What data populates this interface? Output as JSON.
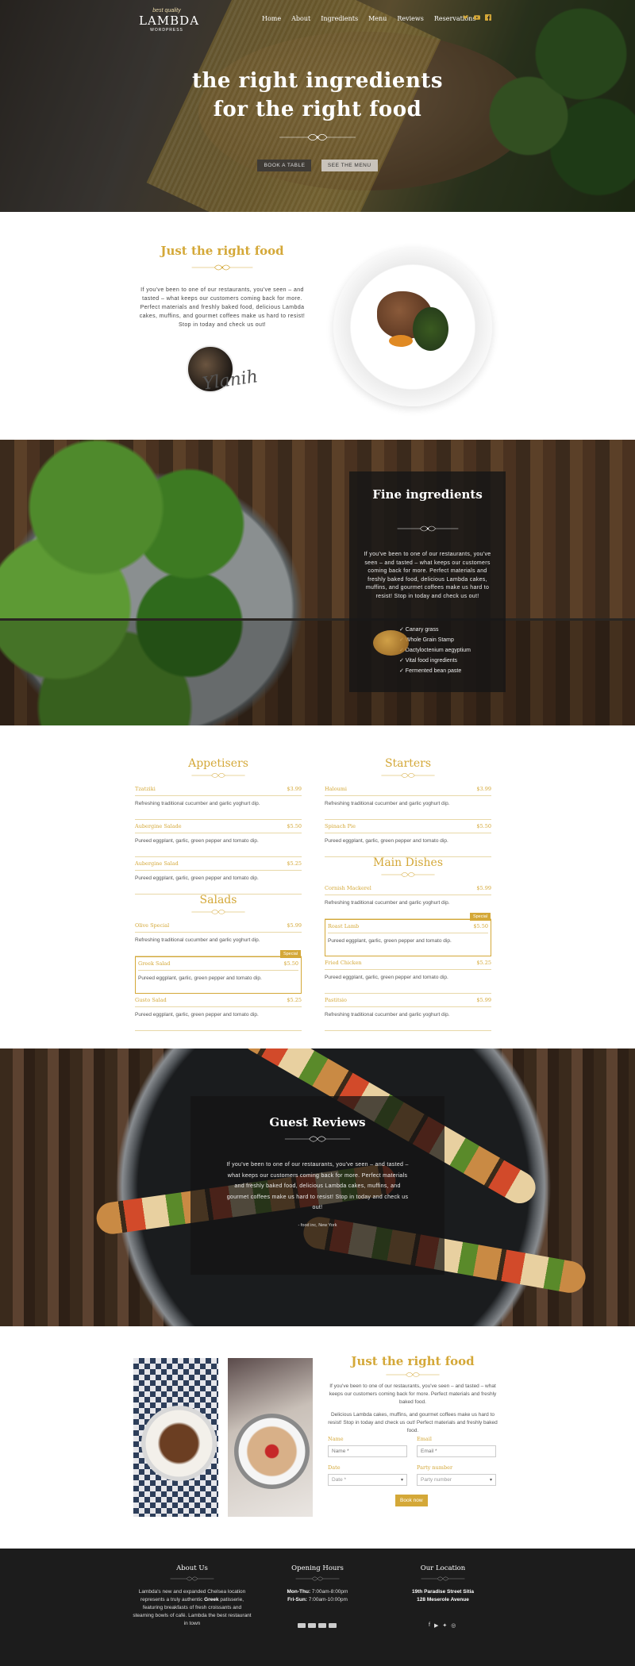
{
  "header": {
    "logo_small": "best quality",
    "logo_title": "LAMBDA",
    "logo_sub": "WORDPRESS",
    "nav": [
      "Home",
      "About",
      "Ingredients",
      "Menu",
      "Reviews",
      "Reservations"
    ],
    "social_icons": [
      "twitter-icon",
      "youtube-icon",
      "facebook-icon"
    ]
  },
  "hero": {
    "title_line1": "the right ingredients",
    "title_line2": "for the right food",
    "book_button": "BOOK A TABLE",
    "menu_button": "SEE THE MENU"
  },
  "about": {
    "title": "Just the right food",
    "text": "If you've been to one of our restaurants, you've seen – and tasted – what keeps our customers coming back for more. Perfect materials and freshly baked food, delicious Lambda cakes, muffins, and gourmet coffees make us hard to resist! Stop in today and check us out!",
    "signature": "Ylanih"
  },
  "fine": {
    "title": "Fine ingredients",
    "text": "If you've been to one of our restaurants, you've seen – and tasted – what keeps our customers coming back for more. Perfect materials and freshly baked food, delicious Lambda cakes, muffins, and gourmet coffees make us hard to resist! Stop in today and check us out!",
    "items": [
      "✓ Canary grass",
      "✓ Whole Grain Stamp",
      "✓ Dactyloctenium aegyptium",
      "✓ Vital food ingredients",
      "✓ Fermented bean paste"
    ]
  },
  "menu": {
    "appetisers": {
      "title": "Appetisers",
      "items": [
        {
          "name": "Tzatziki",
          "price": "$3.99",
          "desc": "Refreshing traditional cucumber and garlic yoghurt dip."
        },
        {
          "name": "Aubergine Salade",
          "price": "$5.50",
          "desc": "Pureed eggplant, garlic, green pepper and tomato dip."
        },
        {
          "name": "Aubergine Salad",
          "price": "$5.25",
          "desc": "Pureed eggplant, garlic, green pepper and tomato dip."
        }
      ]
    },
    "salads": {
      "title": "Salads",
      "items": [
        {
          "name": "Olive Special",
          "price": "$5.99",
          "desc": "Refreshing traditional cucumber and garlic yoghurt dip."
        },
        {
          "name": "Greek Salad",
          "price": "$5.50",
          "desc": "Pureed eggplant, garlic, green pepper and tomato dip.",
          "badge": "Special"
        },
        {
          "name": "Gusto Salad",
          "price": "$5.25",
          "desc": "Pureed eggplant, garlic, green pepper and tomato dip."
        }
      ]
    },
    "starters": {
      "title": "Starters",
      "items": [
        {
          "name": "Haloumi",
          "price": "$3.99",
          "desc": "Refreshing traditional cucumber and garlic yoghurt dip."
        },
        {
          "name": "Spinach Pie",
          "price": "$5.50",
          "desc": "Pureed eggplant, garlic, green pepper and tomato dip."
        }
      ]
    },
    "main": {
      "title": "Main Dishes",
      "items": [
        {
          "name": "Cornish Mackerel",
          "price": "$5.99",
          "desc": "Refreshing traditional cucumber and garlic yoghurt dip."
        },
        {
          "name": "Roast Lamb",
          "price": "$5.50",
          "desc": "Pureed eggplant, garlic, green pepper and tomato dip.",
          "badge": "Special"
        },
        {
          "name": "Fried Chicken",
          "price": "$5.25",
          "desc": "Pureed eggplant, garlic, green pepper and tomato dip."
        },
        {
          "name": "Pastitsio",
          "price": "$5.99",
          "desc": "Refreshing traditional cucumber and garlic yoghurt dip."
        }
      ]
    }
  },
  "reviews": {
    "title": "Guest Reviews",
    "text": "If you've been to one of our restaurants, you've seen – and tasted – what keeps our customers coming back for more. Perfect materials and freshly baked food, delicious Lambda cakes, muffins, and gourmet coffees make us hard to resist! Stop in today and check us out!",
    "author": "- food inc, New York"
  },
  "reserve": {
    "title": "Just the right food",
    "text1": "If you've been to one of our restaurants, you've seen – and tasted – what keeps our customers coming back for more. Perfect materials and freshly baked food.",
    "text2": "Delicious Lambda cakes, muffins, and gourmet coffees make us hard to resist! Stop in today and check us out! Perfect materials and freshly baked food.",
    "name_label": "Name",
    "name_placeholder": "Name *",
    "email_label": "Email",
    "email_placeholder": "Email *",
    "date_label": "Date",
    "date_placeholder": "Date *",
    "party_label": "Party number",
    "party_placeholder": "Party number",
    "book_button": "Book now"
  },
  "footer": {
    "about_title": "About Us",
    "about_text_a": "Lambda's new and expanded Chelsea location represents a truly authentic ",
    "about_text_b": "Greek",
    "about_text_c": " patisserie, featuring breakfasts of fresh croissants and steaming bowls of café. Lambda the best restaurant in town",
    "hours_title": "Opening Hours",
    "hours1_day": "Mon-Thu:",
    "hours1_time": " 7:00am-8:00pm",
    "hours2_day": "Fri-Sun:",
    "hours2_time": " 7:00am-10:00pm",
    "location_title": "Our Location",
    "address1": "19th Paradise Street Sitia",
    "address2": "128 Meserole Avenue",
    "social_icons": [
      "facebook-icon",
      "youtube-icon",
      "twitter-icon",
      "instagram-icon"
    ]
  },
  "colors": {
    "accent": "#d4a838",
    "footer": "#1c1c1c"
  }
}
